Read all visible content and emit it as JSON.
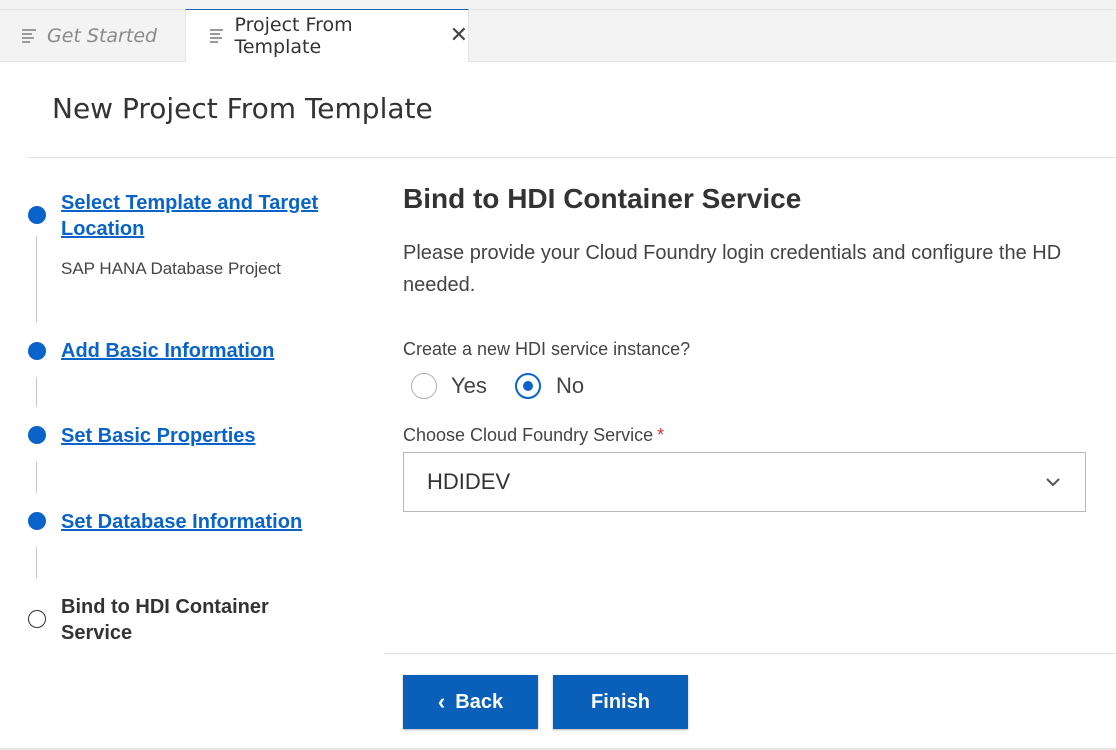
{
  "tabs": [
    {
      "label": "Get Started",
      "active": false
    },
    {
      "label": "Project From Template",
      "active": true
    }
  ],
  "page_title": "New Project From Template",
  "steps": [
    {
      "label_line1": "Select Template and Target",
      "label_line2": "Location",
      "sublabel": "SAP HANA Database Project",
      "completed": true
    },
    {
      "label_line1": "Add Basic Information",
      "completed": true
    },
    {
      "label_line1": "Set Basic Properties",
      "completed": true
    },
    {
      "label_line1": "Set Database Information",
      "completed": true
    },
    {
      "label_line1": "Bind to HDI Container",
      "label_line2": "Service",
      "completed": false,
      "current": true
    }
  ],
  "content": {
    "title": "Bind to HDI Container Service",
    "description_line1": "Please provide your Cloud Foundry login credentials and configure the HD",
    "description_line2": "needed.",
    "create_question": "Create a new HDI service instance?",
    "options": [
      {
        "label": "Yes",
        "checked": false
      },
      {
        "label": "No",
        "checked": true
      }
    ],
    "service_label": "Choose Cloud Foundry Service",
    "required_mark": "*",
    "service_value": "HDIDEV"
  },
  "buttons": {
    "back_label": "Back",
    "finish_label": "Finish"
  },
  "colors": {
    "accent": "#0a63c8",
    "button": "#0a5fb8",
    "required": "#d9342b"
  }
}
